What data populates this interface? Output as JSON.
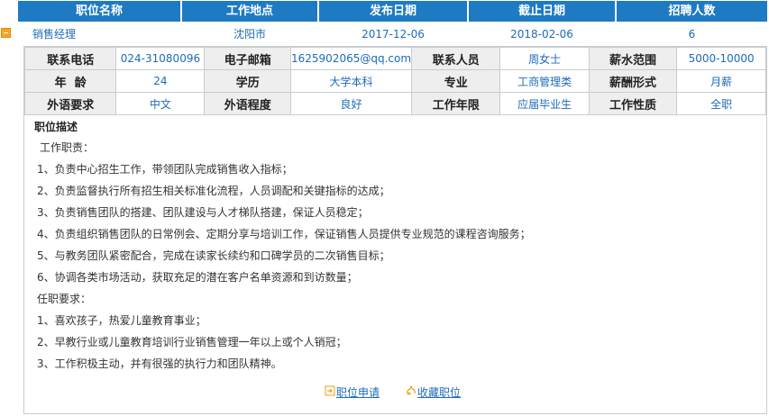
{
  "header": {
    "columns": [
      "职位名称",
      "工作地点",
      "发布日期",
      "截止日期",
      "招聘人数"
    ]
  },
  "job": {
    "title": "销售经理",
    "location": "沈阳市",
    "publish_date": "2017-12-06",
    "deadline": "2018-02-06",
    "headcount": "6"
  },
  "info": {
    "rows": [
      [
        {
          "label": "联系电话",
          "value": "024-31080096"
        },
        {
          "label": "电子邮箱",
          "value": "1625902065@qq.com"
        },
        {
          "label": "联系人员",
          "value": "周女士"
        },
        {
          "label": "薪水范围",
          "value": "5000-10000"
        }
      ],
      [
        {
          "label": "年  龄",
          "value": "24"
        },
        {
          "label": "学历",
          "value": "大学本科"
        },
        {
          "label": "专业",
          "value": "工商管理类"
        },
        {
          "label": "薪酬形式",
          "value": "月薪"
        }
      ],
      [
        {
          "label": "外语要求",
          "value": "中文"
        },
        {
          "label": "外语程度",
          "value": "良好"
        },
        {
          "label": "工作年限",
          "value": "应届毕业生"
        },
        {
          "label": "工作性质",
          "value": "全职"
        }
      ]
    ]
  },
  "description": {
    "title": "职位描述",
    "lines": [
      "工作职责：",
      "1、负责中心招生工作，带领团队完成销售收入指标；",
      "2、负责监督执行所有招生相关标准化流程，人员调配和关键指标的达成；",
      "3、负责销售团队的搭建、团队建设与人才梯队搭建，保证人员稳定；",
      "4、负责组织销售团队的日常例会、定期分享与培训工作，保证销售人员提供专业规范的课程咨询服务；",
      "5、与教务团队紧密配合，完成在读家长续约和口碑学员的二次销售目标；",
      "6、协调各类市场活动，获取充足的潜在客户名单资源和到访数量；",
      "任职要求：",
      "1、喜欢孩子，热爱儿童教育事业；",
      "2、早教行业或儿童教育培训行业销售管理一年以上或个人销冠；",
      "3、工作积极主动，并有很强的执行力和团队精神。"
    ]
  },
  "actions": {
    "apply_label": "职位申请",
    "favorite_label": "收藏职位"
  }
}
